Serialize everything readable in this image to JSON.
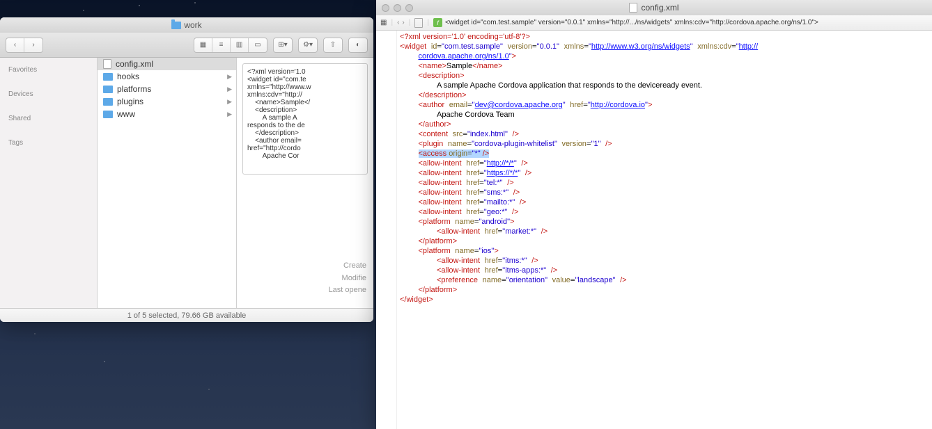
{
  "finder": {
    "title": "work",
    "sidebar": {
      "headings": [
        "Favorites",
        "Devices",
        "Shared",
        "Tags"
      ]
    },
    "files": [
      {
        "name": "config.xml",
        "type": "file",
        "selected": true
      },
      {
        "name": "hooks",
        "type": "folder"
      },
      {
        "name": "platforms",
        "type": "folder"
      },
      {
        "name": "plugins",
        "type": "folder"
      },
      {
        "name": "www",
        "type": "folder"
      }
    ],
    "preview_lines": [
      "<?xml version='1.0",
      "<widget id=\"com.te",
      "xmlns=\"http://www.w",
      "xmlns:cdv=\"http://",
      "    <name>Sample</",
      "    <description>",
      "        A sample A",
      "responds to the de",
      "    </description>",
      "    <author email=",
      "href=\"http://cordo",
      "        Apache Cor"
    ],
    "meta": {
      "created": "Create",
      "modified": "Modifie",
      "opened": "Last opene"
    },
    "status": "1 of 5 selected, 79.66 GB available"
  },
  "editor": {
    "title": "config.xml",
    "toolbar_path": "<widget id=\"com.test.sample\" version=\"0.0.1\" xmlns=\"http://.../ns/widgets\" xmlns:cdv=\"http://cordova.apache.org/ns/1.0\">",
    "nav_prev": "‹",
    "nav_next": "›",
    "xml": {
      "declaration": "<?xml version='1.0' encoding='utf-8'?>",
      "widget_open": {
        "id": "com.test.sample",
        "version": "0.0.1",
        "xmlns": "http://www.w3.org/ns/widgets",
        "xmlns_cdv": "http://cordova.apache.org/ns/1.0"
      },
      "name": "Sample",
      "description": "A sample Apache Cordova application that responds to the deviceready event.",
      "author": {
        "email": "dev@cordova.apache.org",
        "href": "http://cordova.io",
        "text": "Apache Cordova Team"
      },
      "content_src": "index.html",
      "plugin": {
        "name": "cordova-plugin-whitelist",
        "version": "1"
      },
      "access_origin": "*",
      "allow_intents": [
        {
          "href": "http://*/*",
          "link": true
        },
        {
          "href": "https://*/*",
          "link": true
        },
        {
          "href": "tel:*"
        },
        {
          "href": "sms:*"
        },
        {
          "href": "mailto:*"
        },
        {
          "href": "geo:*"
        }
      ],
      "platform_android": {
        "name": "android",
        "allow_intent": "market:*"
      },
      "platform_ios": {
        "name": "ios",
        "allow_intents": [
          "itms:*",
          "itms-apps:*"
        ],
        "preference": {
          "name": "orientation",
          "value": "landscape"
        }
      }
    }
  }
}
